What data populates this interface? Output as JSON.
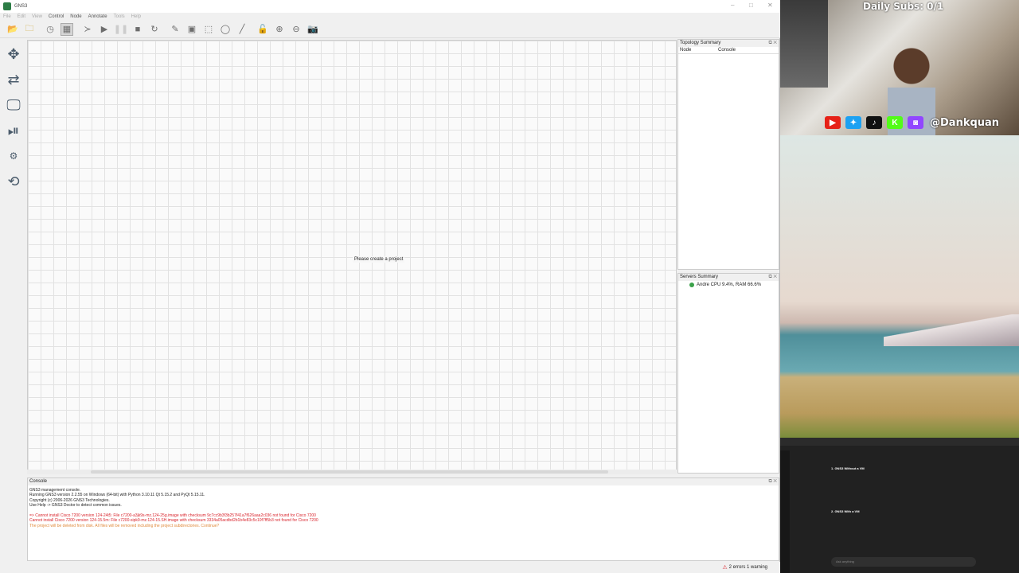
{
  "window": {
    "title": "GNS3"
  },
  "menu": [
    {
      "label": "File",
      "enabled": false
    },
    {
      "label": "Edit",
      "enabled": false
    },
    {
      "label": "View",
      "enabled": false
    },
    {
      "label": "Control",
      "enabled": true
    },
    {
      "label": "Node",
      "enabled": true
    },
    {
      "label": "Annotate",
      "enabled": true
    },
    {
      "label": "Tools",
      "enabled": false
    },
    {
      "label": "Help",
      "enabled": false
    }
  ],
  "toolbar_icons": [
    "open-project-icon",
    "open-folder-icon",
    "snapshot-icon",
    "show-interface-labels-icon",
    "console-all-icon",
    "start-all-icon",
    "suspend-all-icon",
    "stop-all-icon",
    "reload-all-icon",
    "add-note-icon",
    "insert-picture-icon",
    "draw-rectangle-icon",
    "draw-ellipse-icon",
    "draw-line-icon",
    "lock-unlock-icon",
    "zoom-in-icon",
    "zoom-out-icon",
    "screenshot-icon"
  ],
  "node_types": [
    "routers-icon",
    "switches-icon",
    "end-devices-icon",
    "security-devices-icon",
    "all-devices-icon",
    "add-link-icon"
  ],
  "canvas": {
    "hint": "Please create a project"
  },
  "topology_summary": {
    "title": "Topology Summary",
    "columns": [
      "Node",
      "Console"
    ]
  },
  "servers_summary": {
    "title": "Servers Summary",
    "server": "Andre CPU 9.4%, RAM 66.6%"
  },
  "console": {
    "title": "Console",
    "lines": [
      {
        "text": "GNS3 management console.",
        "kind": "normal"
      },
      {
        "text": "Running GNS3 version 2.2.55 on Windows (64-bit) with Python 3.10.11 Qt 5.15.2 and PyQt 5.15.11.",
        "kind": "normal"
      },
      {
        "text": "Copyright (c) 2006-2026 GNS3 Technologies.",
        "kind": "normal"
      },
      {
        "text": "Use Help -> GNS3 Doctor to detect common issues.",
        "kind": "normal"
      },
      {
        "text": "",
        "kind": "normal"
      },
      {
        "text": "=> Cannot install Cisco 7200 version 124-24t5: File c7200-a3jk9s-mz.124-25g.image with checksum 9c7cc9b3f3b257f41a7f626aaa2c036 not found for Cisco 7200",
        "kind": "err"
      },
      {
        "text": "Cannot install Cisco 7200 version 124-15.5m: File c7200-sipk9-mz.124-15.SH.image with checksum 3334a05acdbd2b1b4e83c5c10f7ff5b3 not found for Cisco 7200",
        "kind": "err"
      },
      {
        "text": "The project will be deleted from disk. All files will be removed including the project subdirectories. Continue?",
        "kind": "warn"
      }
    ]
  },
  "status": {
    "text": "2 errors 1 warning"
  },
  "overlay": {
    "subs": "Daily Subs: 0/1",
    "handle": "@Dankquan",
    "social": [
      {
        "icon": "youtube-icon",
        "color": "#e62117",
        "glyph": "▶"
      },
      {
        "icon": "twitter-icon",
        "color": "#1da1f2",
        "glyph": "✦"
      },
      {
        "icon": "tiktok-icon",
        "color": "#111111",
        "glyph": "♪"
      },
      {
        "icon": "kick-icon",
        "color": "#53fc18",
        "glyph": "K"
      },
      {
        "icon": "twitch-icon",
        "color": "#9146ff",
        "glyph": "◙"
      }
    ]
  },
  "chat_window": {
    "heading1": "1. GNS3 Without a VM",
    "heading2": "2. GNS3 With a VM",
    "input_placeholder": "Ask anything"
  }
}
